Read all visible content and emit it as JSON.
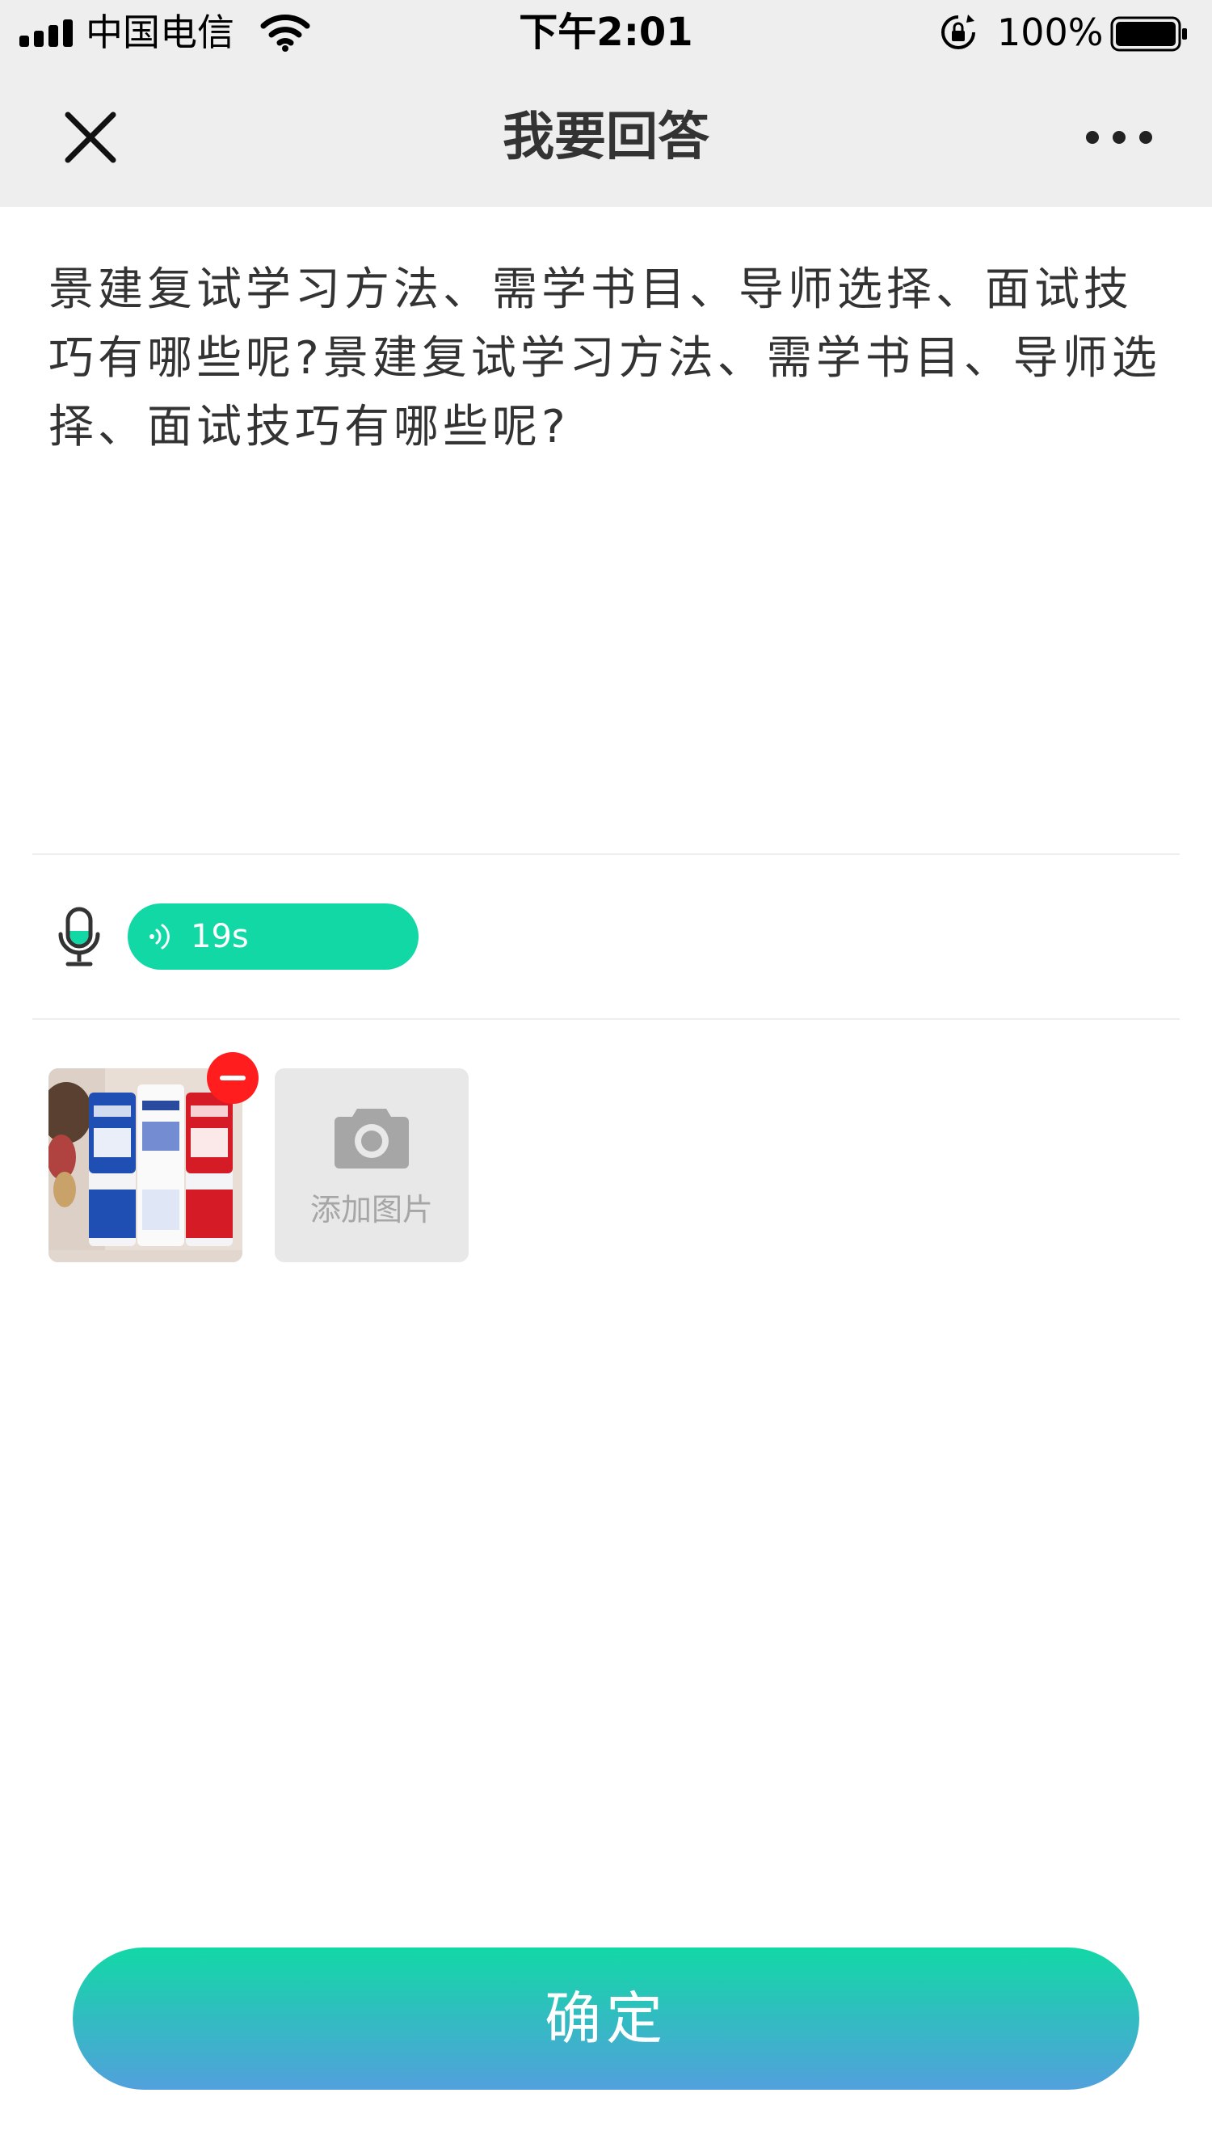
{
  "status_bar": {
    "carrier": "中国电信",
    "time": "下午2:01",
    "battery": "100%",
    "icons": [
      "signal-icon",
      "wifi-icon",
      "orientation-lock-icon",
      "battery-icon"
    ]
  },
  "nav": {
    "title": "我要回答",
    "close_icon": "close-icon",
    "more_icon": "more-icon"
  },
  "question": {
    "text": "景建复试学习方法、需学书目、导师选择、面试技巧有哪些呢?景建复试学习方法、需学书目、导师选择、面试技巧有哪些呢?"
  },
  "voice": {
    "icon": "microphone-icon",
    "duration": "19s",
    "color": "#12d8a6"
  },
  "images": {
    "add_label": "添加图片",
    "add_icon": "camera-icon",
    "remove_icon": "remove-icon",
    "remove_color": "#ff1d1d"
  },
  "actions": {
    "confirm_label": "确定",
    "gradient": [
      "#12d8a6",
      "#52a0dc"
    ]
  }
}
